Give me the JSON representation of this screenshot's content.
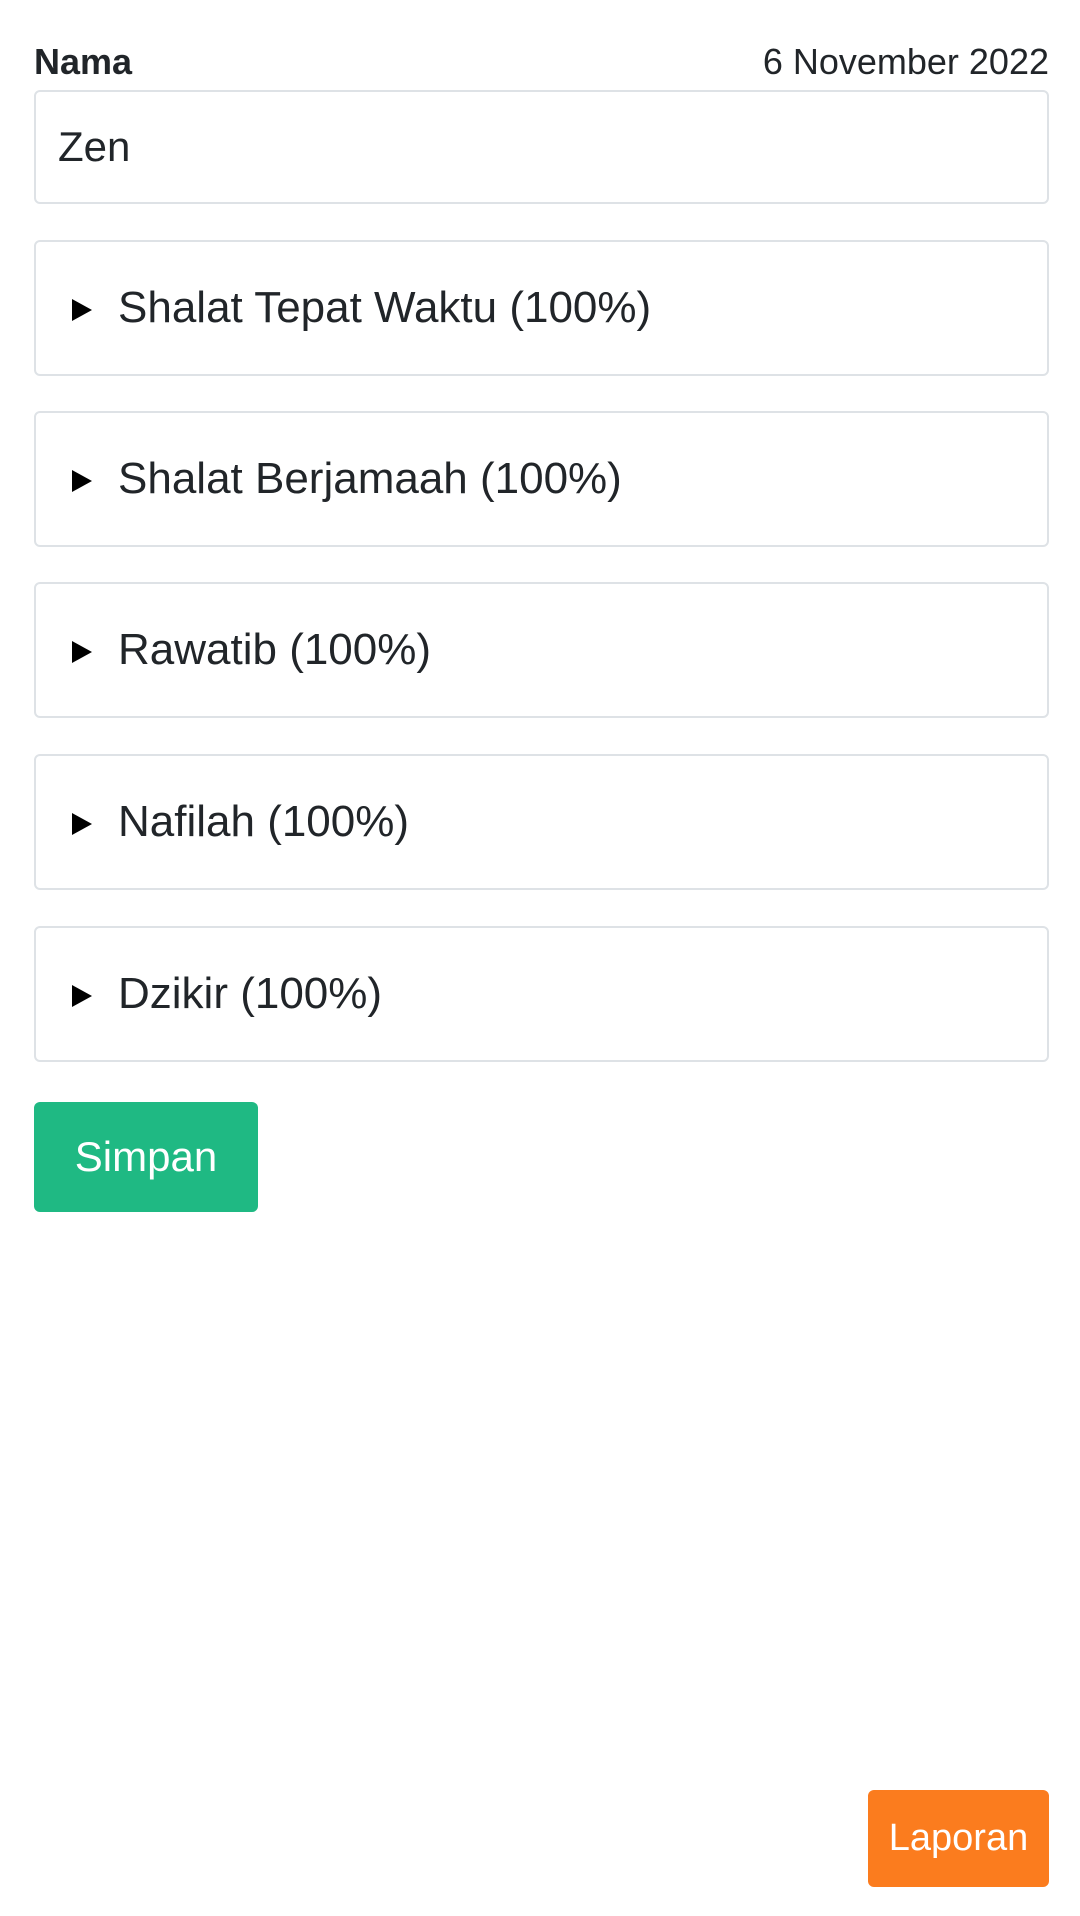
{
  "form": {
    "name_label": "Nama",
    "date": "6 November 2022",
    "name_value": "Zen"
  },
  "sections": [
    {
      "label": "Shalat Tepat Waktu (100%)"
    },
    {
      "label": "Shalat Berjamaah (100%)"
    },
    {
      "label": "Rawatib (100%)"
    },
    {
      "label": "Nafilah (100%)"
    },
    {
      "label": "Dzikir (100%)"
    }
  ],
  "actions": {
    "save_label": "Simpan",
    "report_label": "Laporan"
  },
  "icons": {
    "section_toggle": "caret-right-icon"
  },
  "colors": {
    "save_button": "#1fb983",
    "report_button": "#fb7c1e",
    "border": "#dee2e6"
  }
}
